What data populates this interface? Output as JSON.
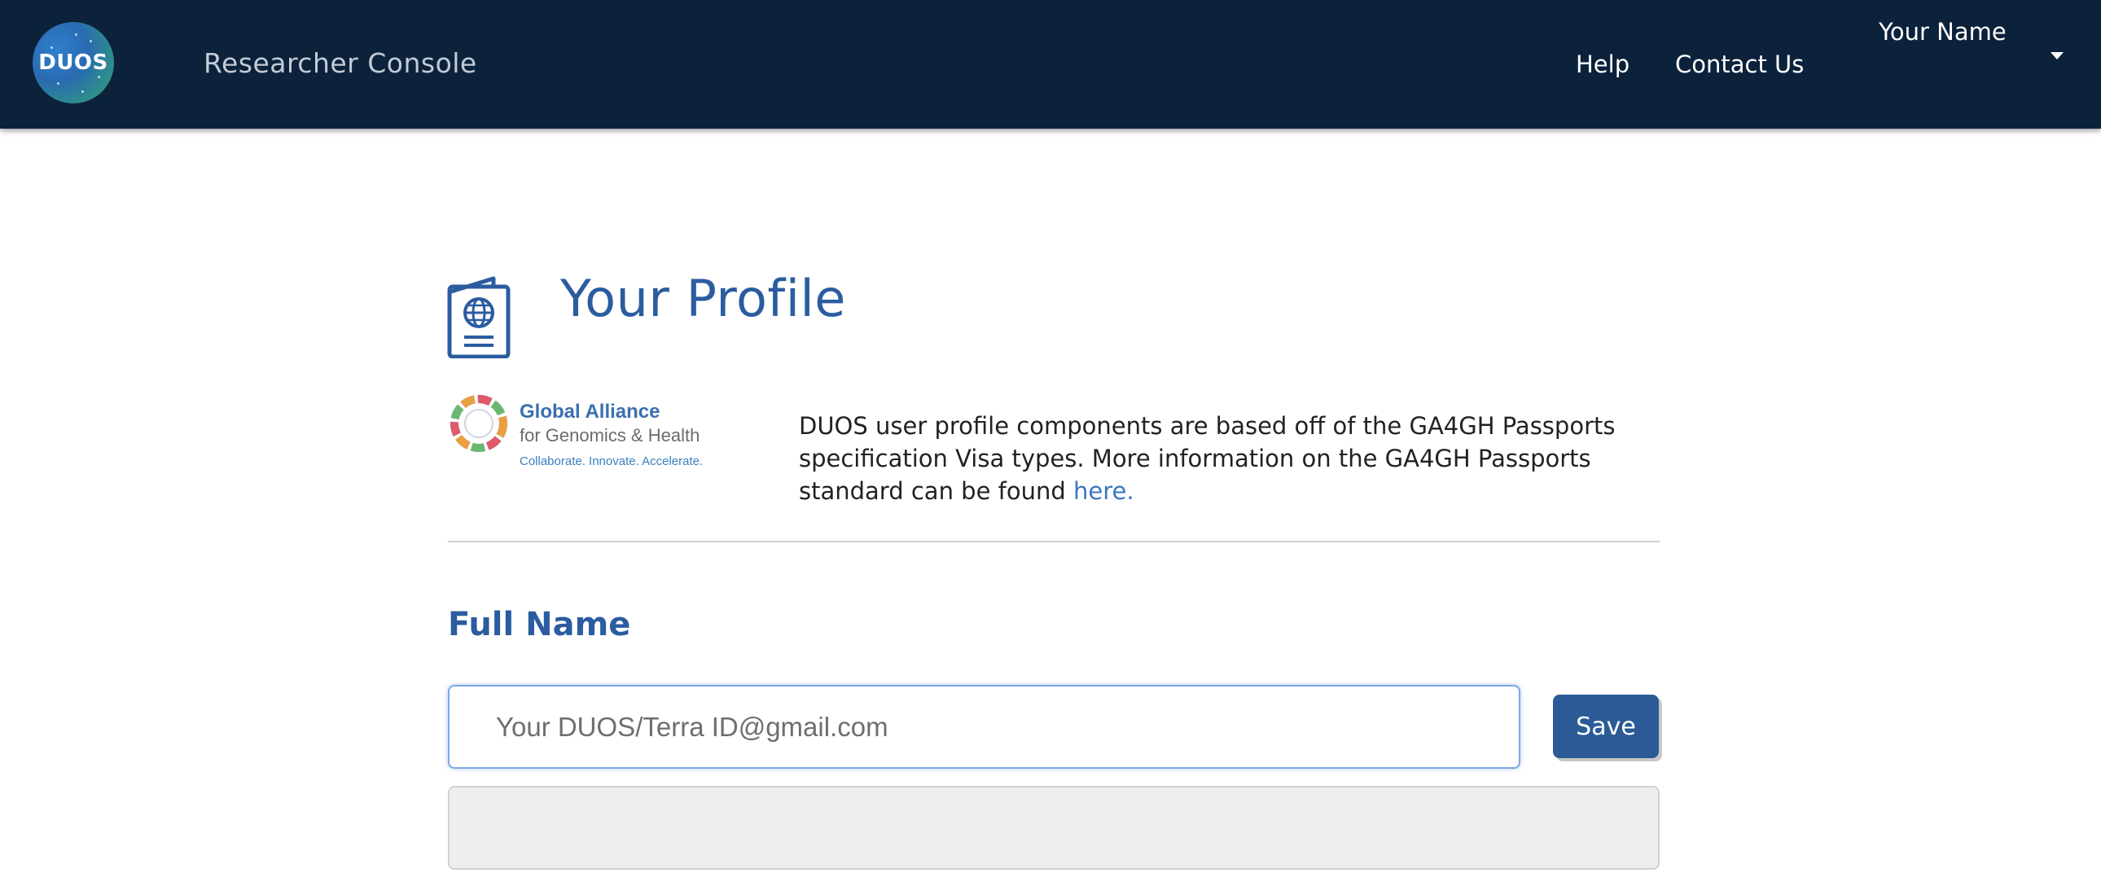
{
  "header": {
    "logo_text": "DUOS",
    "app_title": "Researcher Console",
    "nav": {
      "help": "Help",
      "contact": "Contact Us"
    },
    "user_name": "Your Name"
  },
  "main": {
    "title": "Your Profile",
    "partner_logo": {
      "line1": "Global Alliance",
      "line2": "for Genomics & Health",
      "line3": "Collaborate. Innovate. Accelerate."
    },
    "info_text": "DUOS user profile components are based off of the GA4GH Passports specification Visa types. More information on the GA4GH Passports standard can be found",
    "info_link": "here.",
    "full_name_label": "Full Name",
    "full_name_placeholder": "Your DUOS/Terra ID@gmail.com",
    "save_label": "Save"
  },
  "colors": {
    "header_bg": "#0c223b",
    "accent": "#2b5ca0",
    "button": "#2b5a96",
    "link": "#3a76c0"
  }
}
